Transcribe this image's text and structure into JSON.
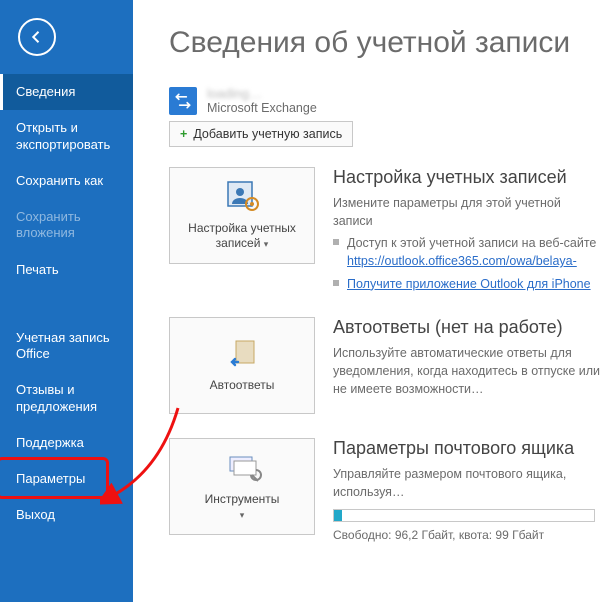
{
  "sidebar": {
    "items": [
      {
        "label": "Сведения",
        "selected": true
      },
      {
        "label": "Открыть и экспортировать"
      },
      {
        "label": "Сохранить как"
      },
      {
        "label": "Сохранить вложения",
        "disabled": true
      },
      {
        "label": "Печать"
      },
      {
        "label": "Учетная запись Office",
        "group": 2
      },
      {
        "label": "Отзывы и предложения",
        "group": 2
      },
      {
        "label": "Поддержка",
        "group": 2
      },
      {
        "label": "Параметры",
        "group": 2,
        "highlighted": true
      },
      {
        "label": "Выход",
        "group": 2
      }
    ]
  },
  "page": {
    "title": "Сведения об учетной записи"
  },
  "account": {
    "name_blurred": "loading…",
    "type": "Microsoft Exchange"
  },
  "add_account": {
    "label": "Добавить учетную запись"
  },
  "sections": {
    "settings": {
      "button": "Настройка учетных записей",
      "title": "Настройка учетных записей",
      "desc": "Измените параметры для этой учетной записи",
      "bullets": [
        {
          "pre": "Доступ к этой учетной записи на веб-сайте",
          "link": "https://outlook.office365.com/owa/belaya-"
        },
        {
          "link": "Получите приложение Outlook для iPhone"
        }
      ]
    },
    "autoreply": {
      "button": "Автоответы",
      "title": "Автоответы (нет на работе)",
      "desc": "Используйте автоматические ответы для уведомления, когда находитесь в отпуске или не имеете возможности…"
    },
    "mailbox": {
      "button": "Инструменты",
      "title": "Параметры почтового ящика",
      "desc": "Управляйте размером почтового ящика, используя…",
      "free": "Свободно: 96,2 Гбайт, квота: 99 Гбайт",
      "used_pct": 3
    }
  }
}
